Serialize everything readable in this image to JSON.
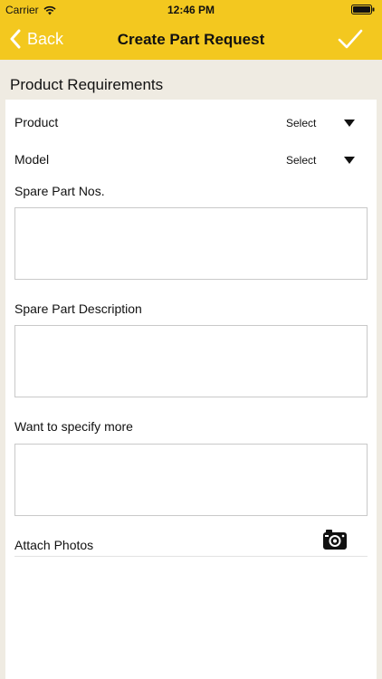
{
  "status_bar": {
    "carrier": "Carrier",
    "time": "12:46 PM"
  },
  "nav": {
    "back_label": "Back",
    "title": "Create Part Request"
  },
  "section": {
    "title": "Product Requirements"
  },
  "form": {
    "product_label": "Product",
    "product_value": "Select",
    "model_label": "Model",
    "model_value": "Select",
    "spare_part_nos_label": "Spare Part Nos.",
    "spare_part_description_label": "Spare Part Description",
    "specify_more_label": "Want to specify more",
    "attach_photos_label": "Attach Photos"
  },
  "colors": {
    "header_bg": "#f3c81f",
    "page_bg": "#efebe2",
    "card_bg": "#ffffff",
    "border": "#c9c9c9"
  },
  "icons": {
    "wifi": "wifi-icon",
    "battery": "battery-icon",
    "back": "chevron-left-icon",
    "done": "checkmark-icon",
    "dropdown": "triangle-down-icon",
    "camera": "camera-icon"
  }
}
